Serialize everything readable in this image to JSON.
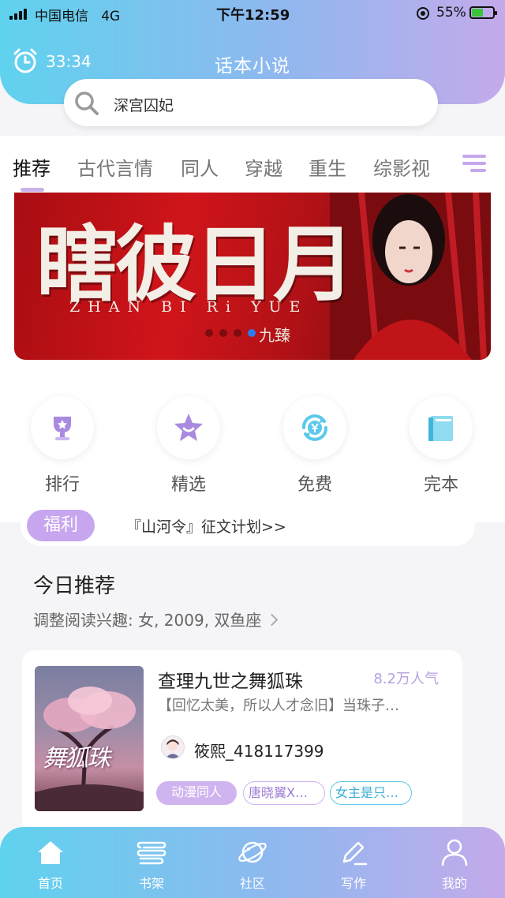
{
  "status_bar": {
    "carrier": "中国电信",
    "network": "4G",
    "time": "下午12:59",
    "battery": "55%"
  },
  "header": {
    "timer": "33:34",
    "title": "话本小说"
  },
  "search": {
    "text": "深宫囚妃"
  },
  "tabs": [
    {
      "label": "推荐",
      "active": true
    },
    {
      "label": "古代言情"
    },
    {
      "label": "同人"
    },
    {
      "label": "穿越"
    },
    {
      "label": "重生"
    },
    {
      "label": "综影视"
    }
  ],
  "banner": {
    "title": "瞎彼日月",
    "subtitle": "ZHAN BI Ri YUE",
    "brand": "九臻"
  },
  "quick_links": [
    {
      "label": "排行",
      "icon": "trophy-icon"
    },
    {
      "label": "精选",
      "icon": "star-icon"
    },
    {
      "label": "免费",
      "icon": "yen-cycle-icon"
    },
    {
      "label": "完本",
      "icon": "book-icon"
    }
  ],
  "welfare": {
    "badge": "福利",
    "text": "『山河令』征文计划>>"
  },
  "today": {
    "title": "今日推荐",
    "subtitle": "调整阅读兴趣: 女, 2009, 双鱼座"
  },
  "book": {
    "title": "查理九世之舞狐珠",
    "popularity": "8.2万人气",
    "description": "【回忆太美，所以人才念旧】当珠子…",
    "author": "筱熙_418117399",
    "cover_title": "舞狐珠",
    "tags": [
      "动漫同人",
      "唐晓翼X自…",
      "女主是只九…"
    ]
  },
  "bottom_nav": [
    {
      "label": "首页",
      "icon": "home-icon",
      "active": true
    },
    {
      "label": "书架",
      "icon": "bookshelf-icon"
    },
    {
      "label": "社区",
      "icon": "planet-icon"
    },
    {
      "label": "写作",
      "icon": "pen-icon"
    },
    {
      "label": "我的",
      "icon": "user-icon"
    }
  ]
}
